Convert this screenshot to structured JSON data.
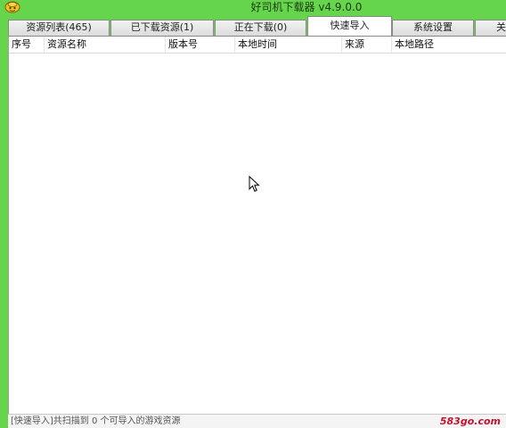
{
  "window": {
    "title": "好司机下载器 v4.9.0.0",
    "frame_color": "#65d64c"
  },
  "tabs": [
    {
      "label": "资源列表(465)",
      "active": false
    },
    {
      "label": "已下载资源(1)",
      "active": false
    },
    {
      "label": "正在下载(0)",
      "active": false
    },
    {
      "label": "快速导入",
      "active": true
    },
    {
      "label": "系统设置",
      "active": false
    },
    {
      "label": "关",
      "active": false
    }
  ],
  "table": {
    "columns": [
      "序号",
      "资源名称",
      "版本号",
      "本地时间",
      "来源",
      "本地路径"
    ],
    "rows": []
  },
  "status": {
    "text": "[快速导入]共扫描到 0 个可导入的游戏资源"
  },
  "watermark": {
    "text": "583go.com"
  }
}
